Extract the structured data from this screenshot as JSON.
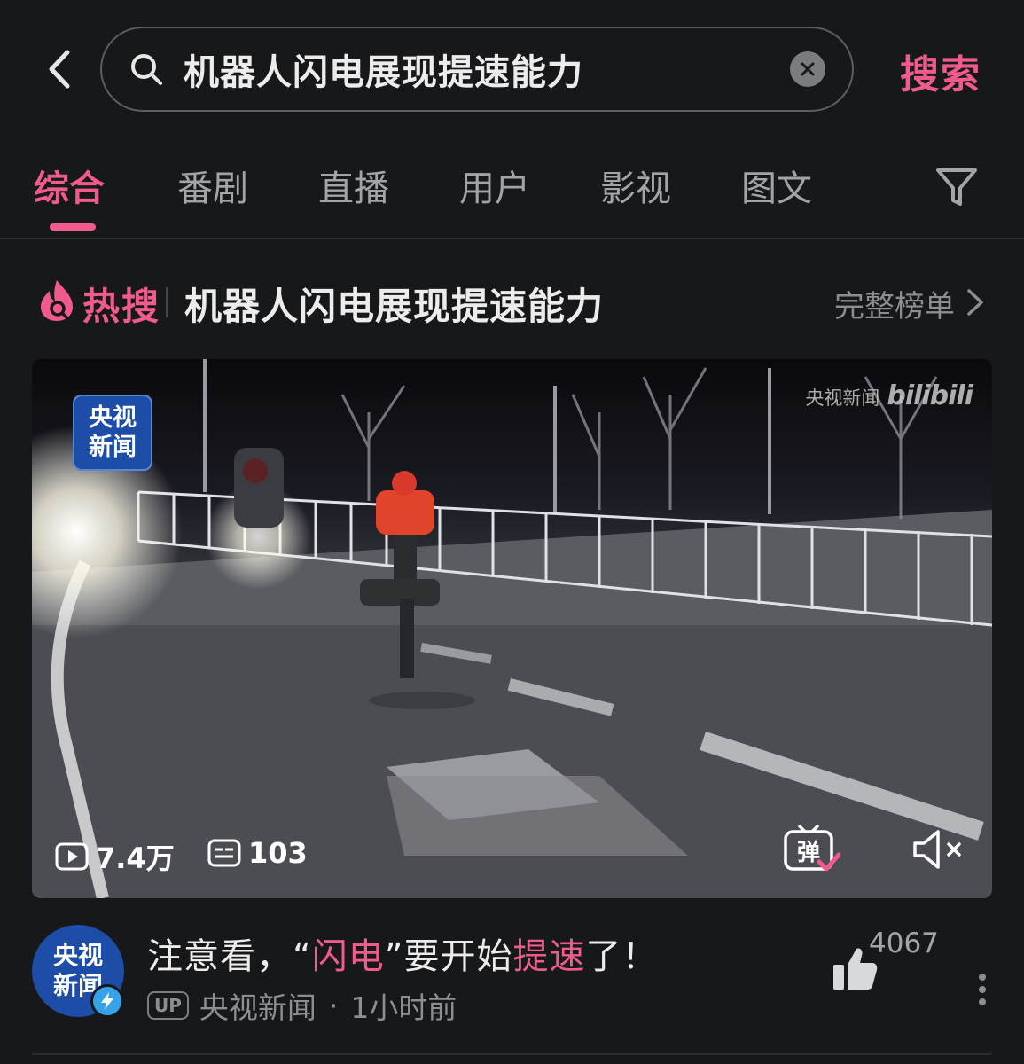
{
  "search": {
    "query": "机器人闪电展现提速能力",
    "submit_label": "搜索"
  },
  "tabs": [
    {
      "label": "综合",
      "active": true
    },
    {
      "label": "番剧",
      "active": false
    },
    {
      "label": "直播",
      "active": false
    },
    {
      "label": "用户",
      "active": false
    },
    {
      "label": "影视",
      "active": false
    },
    {
      "label": "图文",
      "active": false
    }
  ],
  "hot_search": {
    "label": "热搜",
    "title": "机器人闪电展现提速能力",
    "more_label": "完整榜单"
  },
  "video": {
    "badge_line1": "央视",
    "badge_line2": "新闻",
    "watermark_text": "央视新闻",
    "watermark_logo": "bilibili",
    "views": "7.4万",
    "danmaku_count": "103",
    "danmaku_button_label": "弹"
  },
  "result": {
    "title_parts": [
      "注意看，“",
      "闪电",
      "”要开始",
      "提速",
      "了！"
    ],
    "up_tag": "UP",
    "author": "央视新闻",
    "separator": "·",
    "time": "1小时前",
    "likes": "4067",
    "avatar_line1": "央视",
    "avatar_line2": "新闻"
  },
  "colors": {
    "accent": "#f05a8c",
    "background": "#17181a",
    "verify": "#36a3e8",
    "cctv_blue": "#1d4da6"
  }
}
